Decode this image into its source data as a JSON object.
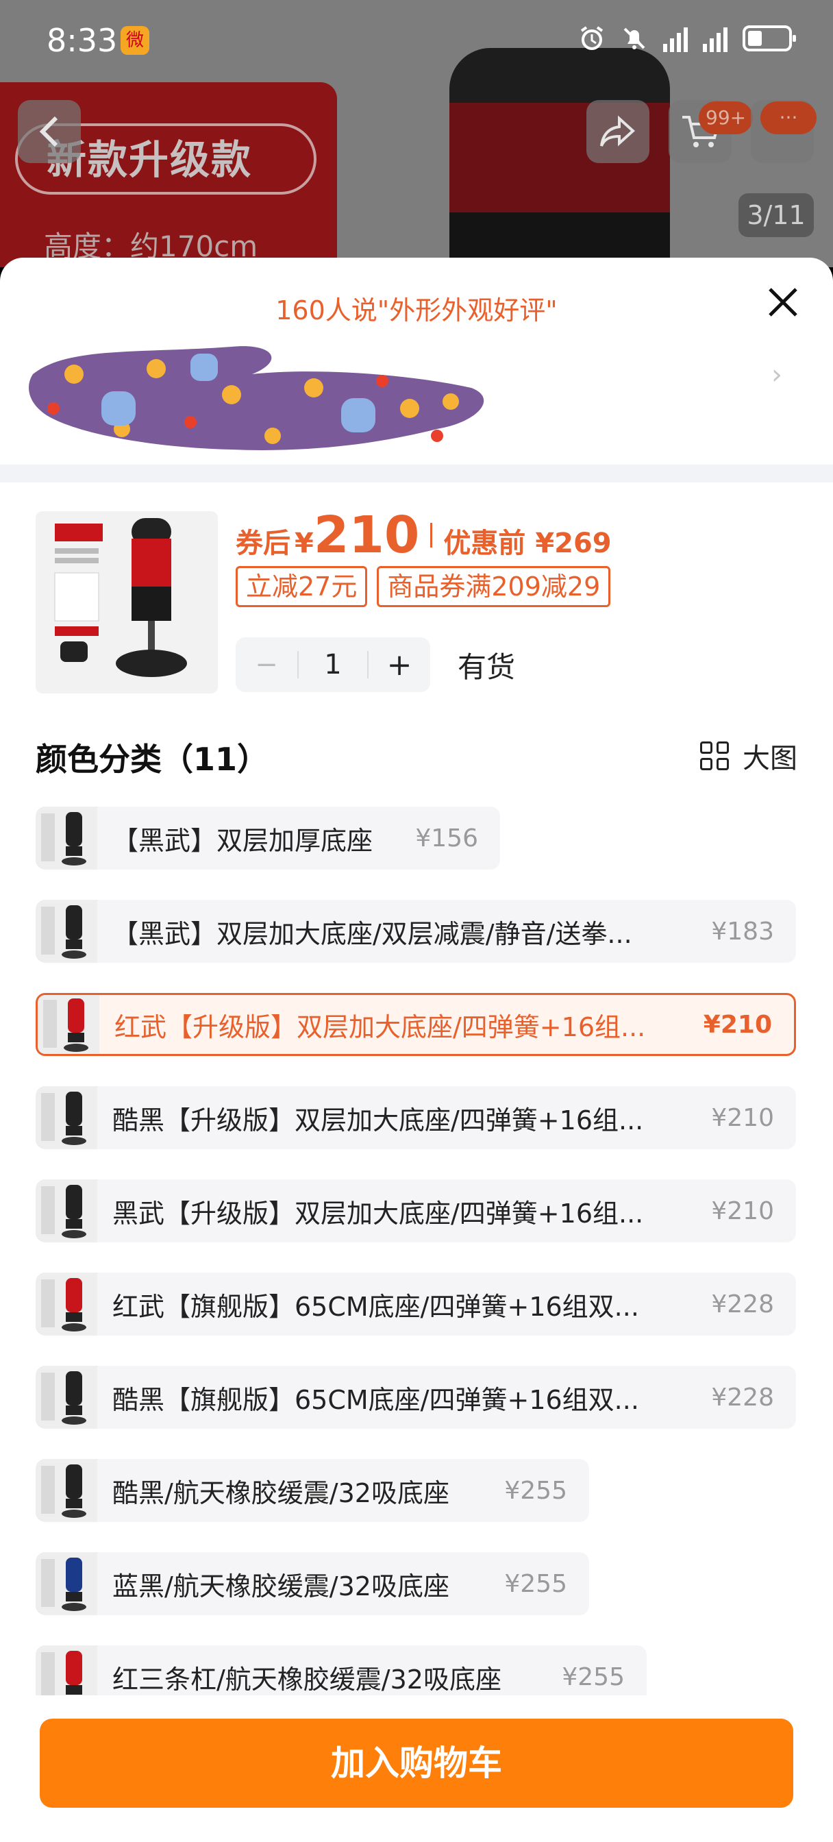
{
  "status_bar": {
    "time": "8:33",
    "app_badge": "微"
  },
  "background": {
    "banner_title": "新款升级款",
    "height_text": "高度：约170cm",
    "pager": "3/11",
    "cart_badge": "99+"
  },
  "review": {
    "title": "160人说\"外形外观好评\""
  },
  "product": {
    "after_label": "券后",
    "currency": "¥",
    "price": "210",
    "before_label": "优惠前",
    "before_price": "¥269",
    "tags": [
      "立减27元",
      "商品券满209减29"
    ],
    "quantity": "1",
    "stock": "有货"
  },
  "options_section": {
    "title": "颜色分类（11）",
    "big_pic_label": "大图"
  },
  "options": [
    {
      "label": "【黑武】双层加厚底座",
      "price": "¥156",
      "selected": false,
      "img_color": "#222"
    },
    {
      "label": "【黑武】双层加大底座/双层减震/静音/送拳...",
      "price": "¥183",
      "selected": false,
      "img_color": "#222"
    },
    {
      "label": "红武【升级版】双层加大底座/四弹簧+16组...",
      "price": "¥210",
      "selected": true,
      "img_color": "#c8151b"
    },
    {
      "label": "酷黑【升级版】双层加大底座/四弹簧+16组...",
      "price": "¥210",
      "selected": false,
      "img_color": "#222"
    },
    {
      "label": "黑武【升级版】双层加大底座/四弹簧+16组...",
      "price": "¥210",
      "selected": false,
      "img_color": "#222"
    },
    {
      "label": "红武【旗舰版】65CM底座/四弹簧+16组双...",
      "price": "¥228",
      "selected": false,
      "img_color": "#c8151b"
    },
    {
      "label": "酷黑【旗舰版】65CM底座/四弹簧+16组双...",
      "price": "¥228",
      "selected": false,
      "img_color": "#222"
    },
    {
      "label": "酷黑/航天橡胶缓震/32吸底座",
      "price": "¥255",
      "selected": false,
      "img_color": "#222"
    },
    {
      "label": "蓝黑/航天橡胶缓震/32吸底座",
      "price": "¥255",
      "selected": false,
      "img_color": "#1c3a8a"
    },
    {
      "label": "红三条杠/航天橡胶缓震/32吸底座",
      "price": "¥255",
      "selected": false,
      "img_color": "#c8151b"
    }
  ],
  "footer": {
    "add_to_cart": "加入购物车"
  },
  "colors": {
    "accent": "#e8602c",
    "button": "#fe7f0a"
  }
}
